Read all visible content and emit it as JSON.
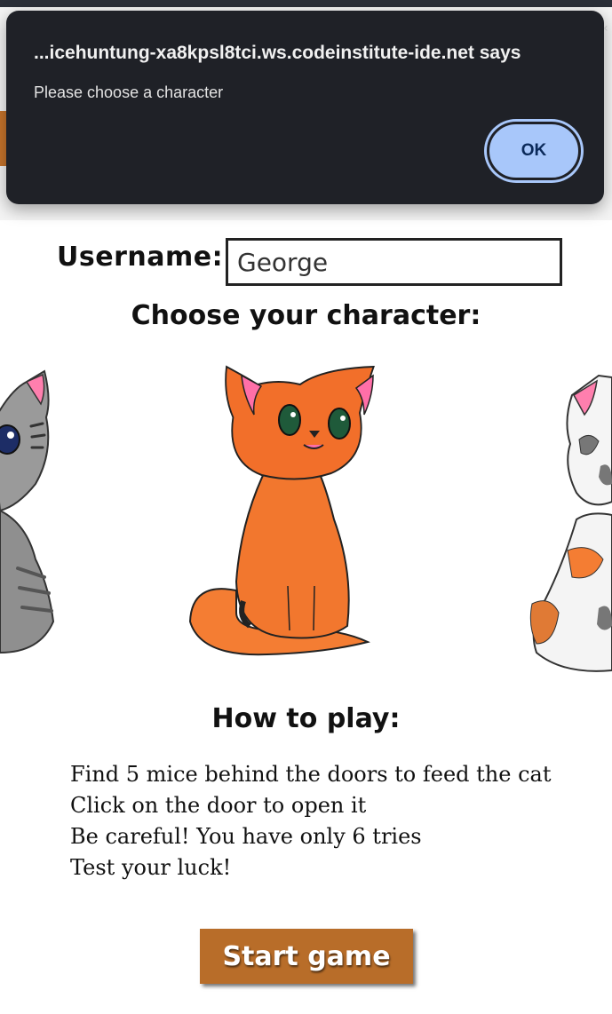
{
  "dialog": {
    "title": "...icehuntung-xa8kpsl8tci.ws.codeinstitute-ide.net says",
    "message": "Please choose a character",
    "ok_label": "OK",
    "accent": "#a8c7fa"
  },
  "form": {
    "username_label": "Username:",
    "username_value": "George"
  },
  "character_heading": "Choose your character:",
  "characters": [
    {
      "name": "grey-cat",
      "color": "#9a9a9a"
    },
    {
      "name": "orange-cat",
      "color": "#f07a2c"
    },
    {
      "name": "calico-cat",
      "color": "#f3f3f3"
    }
  ],
  "how_to_play": {
    "heading": "How to play:",
    "rules": [
      "Find 5 mice behind the doors to feed the cat",
      "Click on the door to open it",
      "Be careful! You have only 6 tries",
      "Test your luck!"
    ]
  },
  "start_button": "Start game",
  "colors": {
    "brand": "#b86d29",
    "dialog_bg": "#1f2127"
  }
}
